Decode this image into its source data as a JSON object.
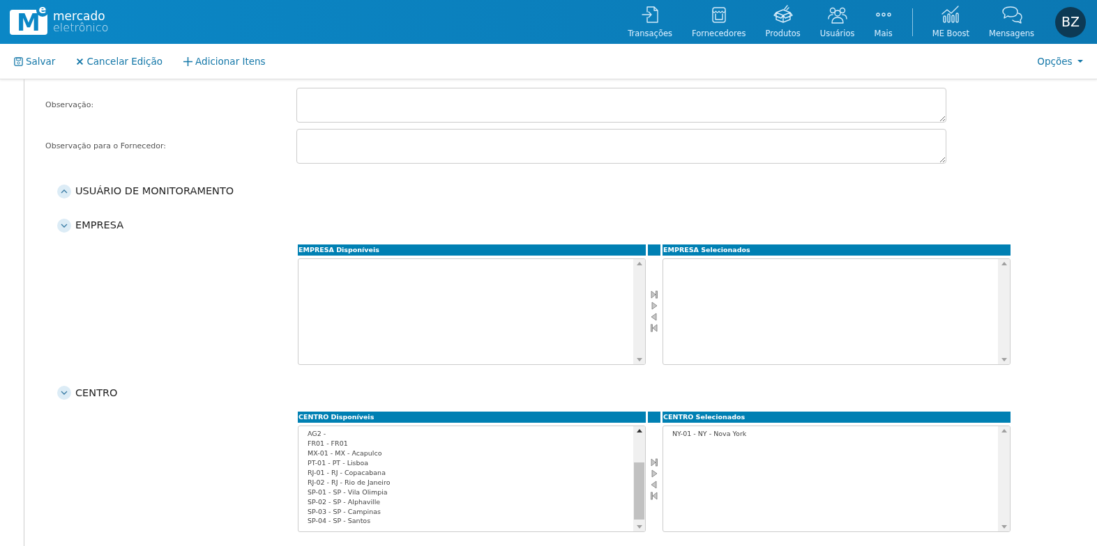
{
  "header": {
    "logo": {
      "mark": "M",
      "mark_sup": "e",
      "line_1": "mercado",
      "line_2": "eletrônico"
    },
    "nav_main": [
      {
        "label": "Transações"
      },
      {
        "label": "Fornecedores"
      },
      {
        "label": "Produtos"
      },
      {
        "label": "Usuários"
      },
      {
        "label": "Mais"
      }
    ],
    "nav_extra": [
      {
        "label": "ME Boost"
      },
      {
        "label": "Mensagens"
      }
    ],
    "avatar": "BZ"
  },
  "toolbar": {
    "actions": [
      {
        "label": "Salvar"
      },
      {
        "label": "Cancelar Edição"
      },
      {
        "label": "Adicionar Itens"
      }
    ],
    "options": "Opções"
  },
  "fields": [
    {
      "label": "Observação:"
    },
    {
      "label": "Observação para o Fornecedor:"
    }
  ],
  "sections": [
    {
      "title": "USUÁRIO DE MONITORAMENTO",
      "expanded": false
    },
    {
      "title": "EMPRESA",
      "expanded": true,
      "available": {
        "header": "EMPRESA Disponíveis"
      },
      "selected": {
        "header": "EMPRESA Selecionados"
      }
    },
    {
      "title": "CENTRO",
      "expanded": true,
      "available": {
        "header": "CENTRO Disponíveis",
        "items": [
          "AG2 -",
          "FR01 - FR01",
          "MX-01 - MX - Acapulco",
          "PT-01 - PT - Lisboa",
          "RJ-01 - RJ - Copacabana",
          "RJ-02 - RJ - Rio de Janeiro",
          "SP-01 - SP - Vila Olimpia",
          "SP-02 - SP - Alphaville",
          "SP-03 - SP - Campinas",
          "SP-04 - SP - Santos"
        ]
      },
      "selected": {
        "header": "CENTRO Selecionados",
        "items": [
          "NY-01 - NY - Nova York"
        ]
      }
    }
  ]
}
